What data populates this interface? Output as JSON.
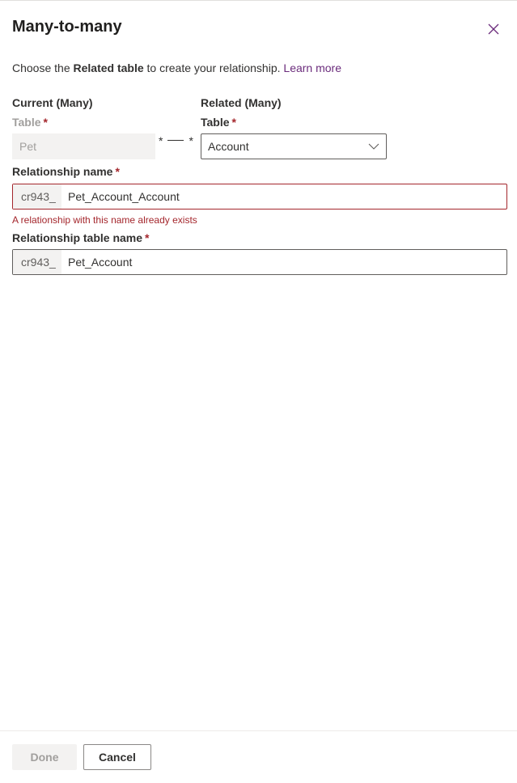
{
  "header": {
    "title": "Many-to-many",
    "close_icon": "close-icon"
  },
  "intro": {
    "prefix": "Choose the ",
    "bold": "Related table",
    "suffix": " to create your relationship. ",
    "link": "Learn more"
  },
  "current": {
    "heading": "Current (Many)",
    "table_label": "Table",
    "required_mark": "*",
    "value": "Pet"
  },
  "connector": {
    "left_star": "*",
    "right_star": "*"
  },
  "related": {
    "heading": "Related (Many)",
    "table_label": "Table",
    "required_mark": "*",
    "selected": "Account",
    "chevron_icon": "chevron-down-icon"
  },
  "relationship_name": {
    "label": "Relationship name",
    "required_mark": "*",
    "prefix": "cr943_",
    "value": "Pet_Account_Account",
    "error": "A relationship with this name already exists"
  },
  "relationship_table_name": {
    "label": "Relationship table name",
    "required_mark": "*",
    "prefix": "cr943_",
    "value": "Pet_Account"
  },
  "footer": {
    "done_label": "Done",
    "cancel_label": "Cancel"
  },
  "colors": {
    "accent": "#6b2c7c",
    "error": "#a4262c",
    "disabled_bg": "#f3f2f1"
  }
}
